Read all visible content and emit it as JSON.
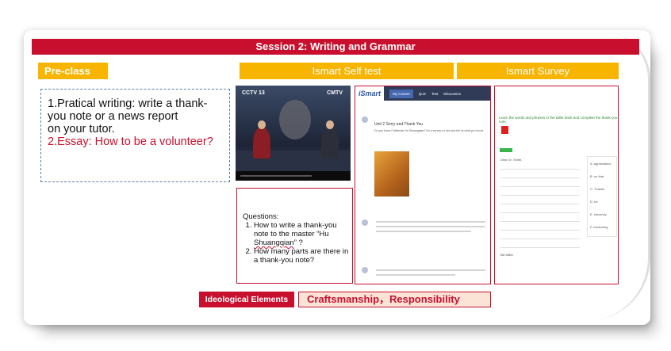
{
  "banner": {
    "title": "Session 2: Writing and Grammar"
  },
  "headers": {
    "preclass": "Pre-class",
    "selftest": "Ismart Self test",
    "survey": "Ismart Survey"
  },
  "task": {
    "line1": "1.Pratical writing: write a thank-",
    "line2": "you note or a news report",
    "line3": "on your tutor.",
    "line4": "2.Essay: How to be a volunteer?"
  },
  "video": {
    "logo_left": "CCTV 13",
    "logo_right": "CMTV"
  },
  "questions": {
    "heading": "Questions:",
    "q1a": "How to write a thank-you note to the master  “Hu ",
    "q1b": "Shuangqian",
    "q1c": "” ?",
    "q2": "How many parts are there in  a thank-you note?"
  },
  "ismart": {
    "logo": "iSmart",
    "tabs": [
      "My Course",
      "Quiz",
      "Test",
      "Discussion"
    ],
    "unit_title": "Unit 2 Sorry and Thank You",
    "subtitle": "Do you know Craftsman Hu Shuangqian? Do a survey on him and tell us what you found."
  },
  "survey": {
    "instruction": "Learn the words and phrases in the table bank and complete the thank-you note.",
    "greeting": "Dear Dr. Smith,",
    "options": [
      "A. appreciated",
      "B. on that",
      "C. Thanks",
      "D. for",
      "E. sincerely",
      "F. beckoning"
    ],
    "sign": "Bill Miller"
  },
  "tags": {
    "ideological": "Ideological Elements",
    "values": "Craftsmanship，Responsibility"
  }
}
